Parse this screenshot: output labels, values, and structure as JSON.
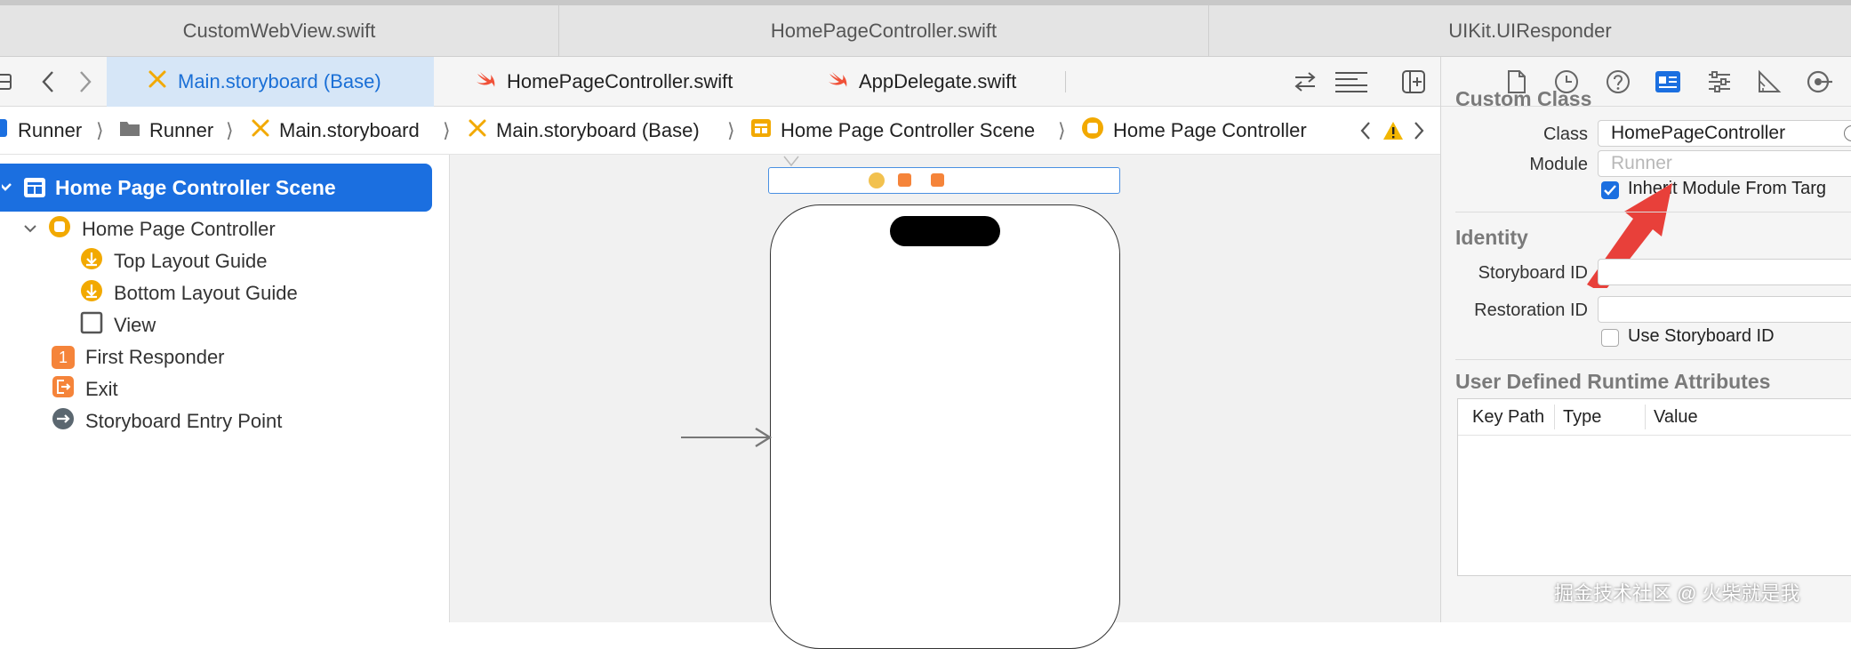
{
  "file_tabs": [
    "CustomWebView.swift",
    "HomePageController.swift",
    "UIKit.UIResponder"
  ],
  "editor_tabs": [
    {
      "label": "Main.storyboard (Base)",
      "icon": "storyboard-icon",
      "active": true
    },
    {
      "label": "HomePageController.swift",
      "icon": "swift-icon",
      "active": false
    },
    {
      "label": "AppDelegate.swift",
      "icon": "swift-icon",
      "active": false
    }
  ],
  "breadcrumb": [
    "Runner",
    "Runner",
    "Main.storyboard",
    "Main.storyboard (Base)",
    "Home Page Controller Scene",
    "Home Page Controller"
  ],
  "outline": {
    "scene": "Home Page Controller Scene",
    "controller": "Home Page Controller",
    "children": [
      "Top Layout Guide",
      "Bottom Layout Guide",
      "View"
    ],
    "items": [
      "First Responder",
      "Exit",
      "Storyboard Entry Point"
    ],
    "first_responder_badge": "1"
  },
  "inspector": {
    "custom_class": {
      "title": "Custom Class",
      "class_label": "Class",
      "class_value": "HomePageController",
      "module_label": "Module",
      "module_placeholder": "Runner",
      "inherit_label": "Inherit Module From Targ",
      "inherit_checked": true
    },
    "identity": {
      "title": "Identity",
      "storyboard_id_label": "Storyboard ID",
      "storyboard_id_value": "",
      "restoration_id_label": "Restoration ID",
      "restoration_id_value": "",
      "use_storyboard_label": "Use Storyboard ID",
      "use_storyboard_checked": false
    },
    "runtime": {
      "title": "User Defined Runtime Attributes",
      "columns": [
        "Key Path",
        "Type",
        "Value"
      ]
    }
  },
  "watermark": "掘金技术社区 @ 火柴就是我",
  "colors": {
    "accent": "#1b6fe0",
    "swift": "#f05138",
    "storyboard": "#f2a900",
    "arrow": "#e8403a"
  }
}
